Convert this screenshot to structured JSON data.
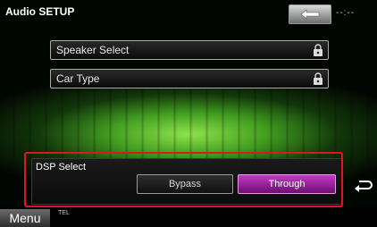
{
  "header": {
    "title": "Audio SETUP",
    "clock": "--:--"
  },
  "rows": [
    {
      "label": "Speaker Select",
      "icon": "lock-icon"
    },
    {
      "label": "Car Type",
      "icon": "lock-icon"
    }
  ],
  "dsp": {
    "label": "DSP Select",
    "options": [
      "Bypass",
      "Through"
    ],
    "selected": "Through"
  },
  "bottom": {
    "menu_label": "Menu",
    "status_tel": "TEL"
  },
  "colors": {
    "highlight_border": "#e1141f",
    "selected_option": "#b22bb6",
    "background_glow": "#6fd13a"
  }
}
